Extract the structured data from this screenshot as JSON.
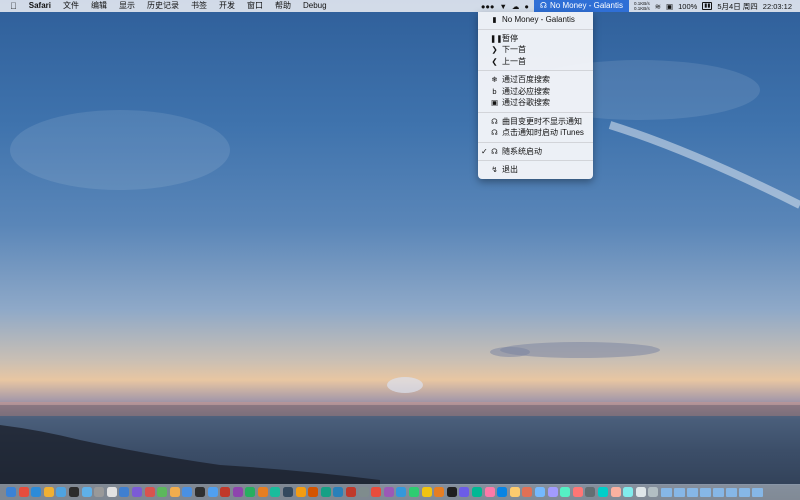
{
  "menubar": {
    "apple_icon": "apple-icon",
    "app_name": "Safari",
    "menus": [
      "文件",
      "编辑",
      "显示",
      "历史记录",
      "书签",
      "开发",
      "窗口",
      "帮助",
      "Debug"
    ],
    "status": {
      "now_playing": "No Money - Galantis",
      "net_up": "0.1KB/s",
      "net_down": "0.1KB/s",
      "battery": "100%",
      "date": "5月4日 周四",
      "time": "22:03:12"
    }
  },
  "dropdown": {
    "header": "No Money - Galantis",
    "playback": [
      "暂停",
      "下一首",
      "上一首"
    ],
    "search": [
      "通过百度搜索",
      "通过必应搜索",
      "通过谷歌搜索"
    ],
    "options": [
      "曲目变更时不显示通知",
      "点击通知时启动 iTunes"
    ],
    "launch_at_login": "随系统启动",
    "launch_checked_mark": "✓",
    "quit": "退出"
  },
  "dock": {
    "app_colors": [
      "#3b82d6",
      "#e64d3d",
      "#2d8bd8",
      "#f0b032",
      "#4fa3e0",
      "#2b2b2b",
      "#5fb0e8",
      "#999999",
      "#e2e2e2",
      "#3f7fd0",
      "#7b5bd6",
      "#d9534f",
      "#5cb85c",
      "#f0ad4e",
      "#4a90e2",
      "#2f2f2f",
      "#50a0f0",
      "#c0392b",
      "#8e44ad",
      "#27ae60",
      "#e67e22",
      "#1abc9c",
      "#34495e",
      "#f39c12",
      "#d35400",
      "#16a085",
      "#2980b9",
      "#c0392b",
      "#7f8c8d",
      "#e74c3c",
      "#9b59b6",
      "#3498db",
      "#2ecc71",
      "#f1c40f",
      "#e67e22",
      "#1f1f1f",
      "#6c5ce7",
      "#00b894",
      "#fd79a8",
      "#0984e3",
      "#fdcb6e",
      "#e17055",
      "#74b9ff",
      "#a29bfe",
      "#55efc4",
      "#ff7675",
      "#636e72",
      "#00cec9",
      "#fab1a0",
      "#81ecec",
      "#dfe6e9",
      "#b2bec3"
    ],
    "folder_count": 8
  }
}
